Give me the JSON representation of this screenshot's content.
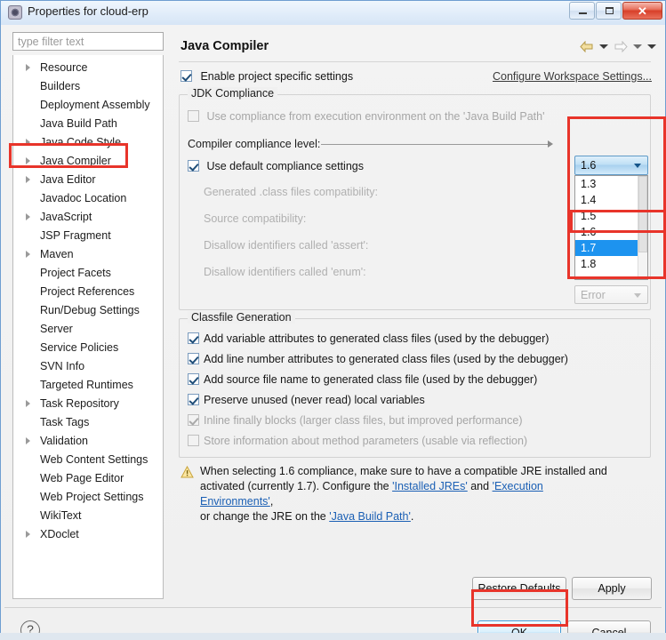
{
  "window": {
    "title": "Properties for cloud-erp",
    "icon": "properties-icon",
    "minimize_label": "Minimize",
    "maximize_label": "Restore",
    "close_label": "Close",
    "close_glyph": "✕"
  },
  "sidebar": {
    "filter": {
      "placeholder": "type filter text",
      "value": ""
    },
    "items": [
      {
        "label": "Resource",
        "expandable": true
      },
      {
        "label": "Builders",
        "expandable": false
      },
      {
        "label": "Deployment Assembly",
        "expandable": false
      },
      {
        "label": "Java Build Path",
        "expandable": false
      },
      {
        "label": "Java Code Style",
        "expandable": true
      },
      {
        "label": "Java Compiler",
        "expandable": true,
        "highlighted": true
      },
      {
        "label": "Java Editor",
        "expandable": true
      },
      {
        "label": "Javadoc Location",
        "expandable": false
      },
      {
        "label": "JavaScript",
        "expandable": true
      },
      {
        "label": "JSP Fragment",
        "expandable": false
      },
      {
        "label": "Maven",
        "expandable": true
      },
      {
        "label": "Project Facets",
        "expandable": false
      },
      {
        "label": "Project References",
        "expandable": false
      },
      {
        "label": "Run/Debug Settings",
        "expandable": false
      },
      {
        "label": "Server",
        "expandable": false
      },
      {
        "label": "Service Policies",
        "expandable": false
      },
      {
        "label": "SVN Info",
        "expandable": false
      },
      {
        "label": "Targeted Runtimes",
        "expandable": false
      },
      {
        "label": "Task Repository",
        "expandable": true
      },
      {
        "label": "Task Tags",
        "expandable": false
      },
      {
        "label": "Validation",
        "expandable": true
      },
      {
        "label": "Web Content Settings",
        "expandable": false
      },
      {
        "label": "Web Page Editor",
        "expandable": false
      },
      {
        "label": "Web Project Settings",
        "expandable": false
      },
      {
        "label": "WikiText",
        "expandable": false
      },
      {
        "label": "XDoclet",
        "expandable": true
      }
    ]
  },
  "panel": {
    "title": "Java Compiler",
    "nav": {
      "back_icon": "back-arrow-icon",
      "back_menu_icon": "chevron-down-icon",
      "forward_icon": "forward-arrow-icon",
      "forward_menu_icon": "chevron-down-icon",
      "view_menu_icon": "chevron-down-icon"
    },
    "enable_project_specific": {
      "label": "Enable project specific settings",
      "checked": true
    },
    "configure_workspace_link": "Configure Workspace Settings...",
    "jdk_compliance": {
      "legend": "JDK Compliance",
      "use_execution_env": {
        "label": "Use compliance from execution environment on the 'Java Build Path'",
        "checked": false,
        "enabled": false
      },
      "compiler_compliance_level_label": "Compiler compliance level:",
      "compiler_compliance_level_value": "1.6",
      "use_default_compliance": {
        "label": "Use default compliance settings",
        "checked": true
      },
      "generated_class_label": "Generated .class files compatibility:",
      "source_compat_label": "Source compatibility:",
      "disallow_assert_label": "Disallow identifiers called 'assert':",
      "disallow_enum_label": "Disallow identifiers called 'enum':",
      "severity_value": "Error"
    },
    "dropdown": {
      "open": true,
      "options": [
        "1.3",
        "1.4",
        "1.5",
        "1.6",
        "1.7",
        "1.8"
      ],
      "selected": "1.7"
    },
    "classfile_generation": {
      "legend": "Classfile Generation",
      "items": [
        {
          "label": "Add variable attributes to generated class files (used by the debugger)",
          "checked": true,
          "enabled": true
        },
        {
          "label": "Add line number attributes to generated class files (used by the debugger)",
          "checked": true,
          "enabled": true
        },
        {
          "label": "Add source file name to generated class file (used by the debugger)",
          "checked": true,
          "enabled": true
        },
        {
          "label": "Preserve unused (never read) local variables",
          "checked": true,
          "enabled": true
        },
        {
          "label": "Inline finally blocks (larger class files, but improved performance)",
          "checked": true,
          "enabled": false
        },
        {
          "label": "Store information about method parameters (usable via reflection)",
          "checked": false,
          "enabled": false
        }
      ]
    },
    "warning": {
      "icon": "warning-triangle-icon",
      "line1_a": "When selecting 1.6 compliance, make sure to have a compatible JRE installed and",
      "line2_a": "activated (currently 1.7). Configure the ",
      "link_installed_jres": "'Installed JREs'",
      "line2_b": " and ",
      "link_execution_envs": "'Execution Environments'",
      "line2_c": ",",
      "line3_a": "or change the JRE on the ",
      "link_java_build_path": "'Java Build Path'",
      "line3_b": "."
    },
    "restore_defaults_label": "Restore Defaults",
    "apply_label": "Apply"
  },
  "footer": {
    "help_label": "?",
    "ok_label": "OK",
    "cancel_label": "Cancel"
  },
  "colors": {
    "accent": "#1d93ef",
    "annotation": "#e8342a",
    "link": "#1a5fb4",
    "titlebar": "#e2edfa"
  }
}
